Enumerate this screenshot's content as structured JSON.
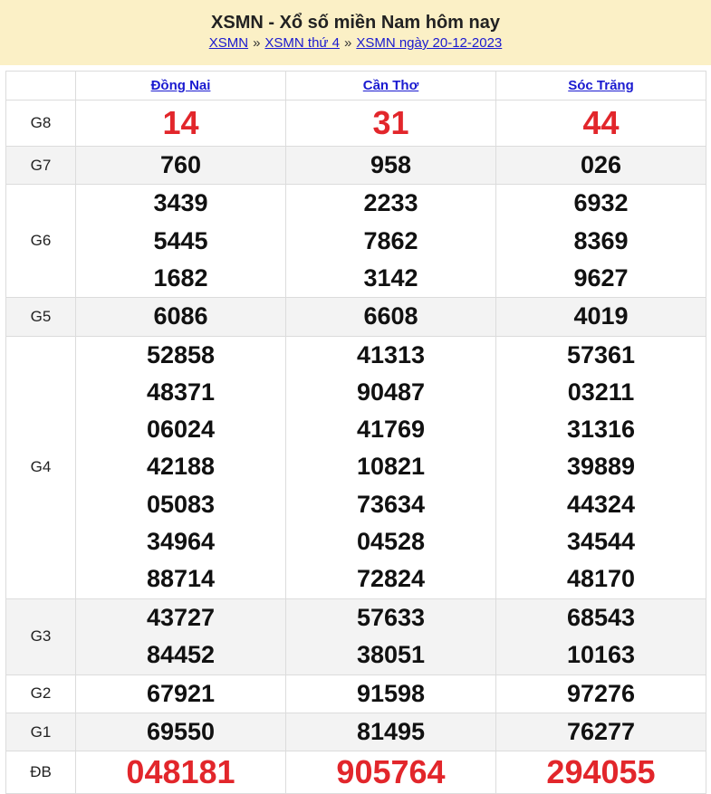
{
  "header": {
    "title": "XSMN - Xổ số miền Nam hôm nay",
    "breadcrumb": [
      {
        "label": "XSMN"
      },
      {
        "label": "XSMN thứ 4"
      },
      {
        "label": "XSMN ngày 20-12-2023"
      }
    ],
    "separator": "»"
  },
  "provinces": [
    "Đồng Nai",
    "Cần Thơ",
    "Sóc Trăng"
  ],
  "colors": {
    "header_bg": "#fbf0c6",
    "link": "#1a1ad0",
    "red": "#e2262b",
    "alt_row": "#f3f3f3"
  },
  "prizes": [
    {
      "label": "G8",
      "values": [
        [
          "14"
        ],
        [
          "31"
        ],
        [
          "44"
        ]
      ]
    },
    {
      "label": "G7",
      "values": [
        [
          "760"
        ],
        [
          "958"
        ],
        [
          "026"
        ]
      ]
    },
    {
      "label": "G6",
      "values": [
        [
          "3439",
          "5445",
          "1682"
        ],
        [
          "2233",
          "7862",
          "3142"
        ],
        [
          "6932",
          "8369",
          "9627"
        ]
      ]
    },
    {
      "label": "G5",
      "values": [
        [
          "6086"
        ],
        [
          "6608"
        ],
        [
          "4019"
        ]
      ]
    },
    {
      "label": "G4",
      "values": [
        [
          "52858",
          "48371",
          "06024",
          "42188",
          "05083",
          "34964",
          "88714"
        ],
        [
          "41313",
          "90487",
          "41769",
          "10821",
          "73634",
          "04528",
          "72824"
        ],
        [
          "57361",
          "03211",
          "31316",
          "39889",
          "44324",
          "34544",
          "48170"
        ]
      ]
    },
    {
      "label": "G3",
      "values": [
        [
          "43727",
          "84452"
        ],
        [
          "57633",
          "38051"
        ],
        [
          "68543",
          "10163"
        ]
      ]
    },
    {
      "label": "G2",
      "values": [
        [
          "67921"
        ],
        [
          "91598"
        ],
        [
          "97276"
        ]
      ]
    },
    {
      "label": "G1",
      "values": [
        [
          "69550"
        ],
        [
          "81495"
        ],
        [
          "76277"
        ]
      ]
    },
    {
      "label": "ĐB",
      "values": [
        [
          "048181"
        ],
        [
          "905764"
        ],
        [
          "294055"
        ]
      ]
    }
  ]
}
